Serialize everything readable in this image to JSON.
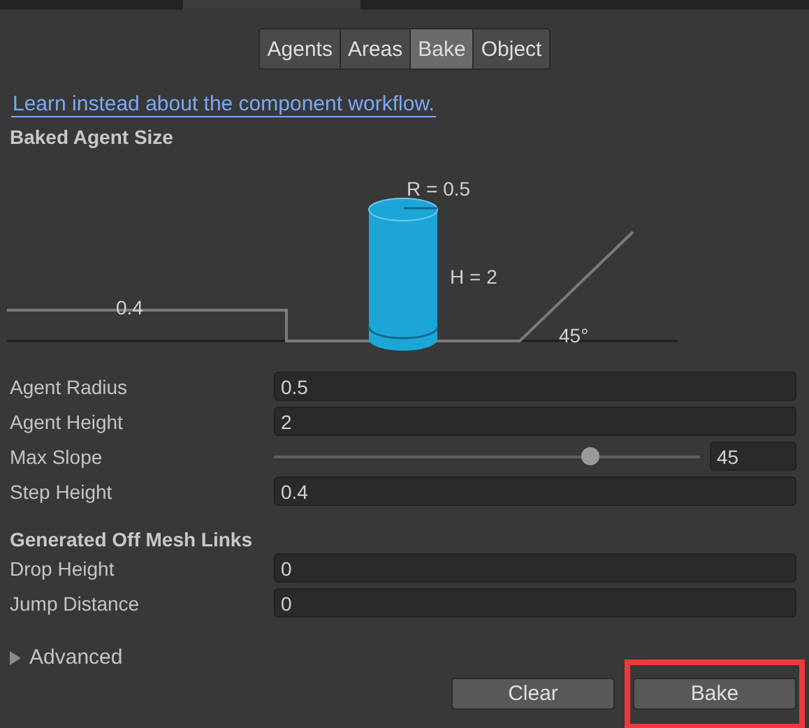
{
  "tabs": [
    {
      "label": "Agents",
      "selected": false
    },
    {
      "label": "Areas",
      "selected": false
    },
    {
      "label": "Bake",
      "selected": true
    },
    {
      "label": "Object",
      "selected": false
    }
  ],
  "link": "Learn instead about the component workflow.",
  "agent_size": {
    "title": "Baked Agent Size",
    "diagram": {
      "radius_label": "R = 0.5",
      "height_label": "H = 2",
      "step_label": "0.4",
      "slope_label": "45°"
    },
    "fields": [
      {
        "kind": "field",
        "label": "Agent Radius",
        "value": "0.5"
      },
      {
        "kind": "field",
        "label": "Agent Height",
        "value": "2"
      },
      {
        "kind": "slider",
        "label": "Max Slope",
        "value": "45",
        "level": 0.74
      },
      {
        "kind": "field",
        "label": "Step Height",
        "value": "0.4"
      }
    ]
  },
  "off_mesh_links": {
    "title": "Generated Off Mesh Links",
    "fields": [
      {
        "kind": "field",
        "label": "Drop Height",
        "value": "0"
      },
      {
        "kind": "field",
        "label": "Jump Distance",
        "value": "0"
      }
    ]
  },
  "advanced": {
    "label": "Advanced",
    "expanded": false
  },
  "buttons": [
    {
      "label": "Clear",
      "highlighted": false
    },
    {
      "label": "Bake",
      "highlighted": true
    }
  ]
}
